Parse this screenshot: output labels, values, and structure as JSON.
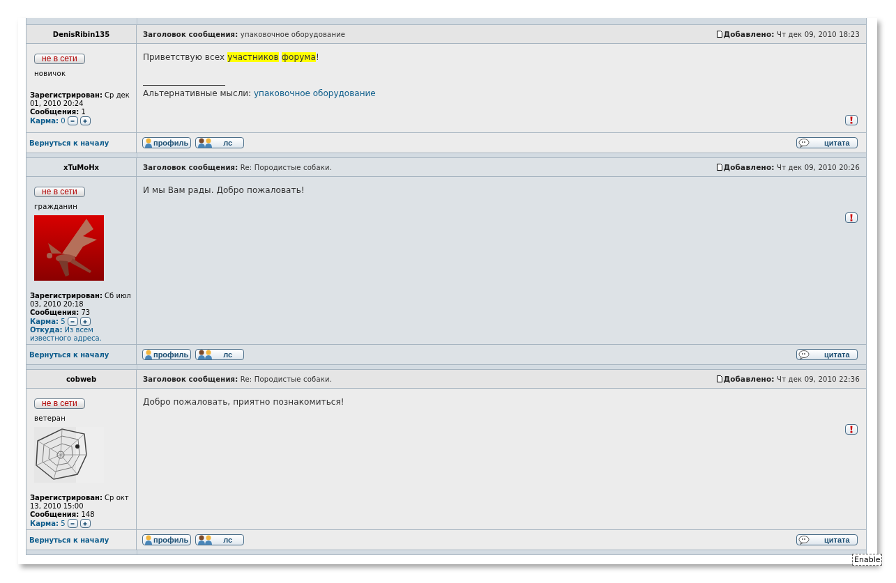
{
  "posts": [
    {
      "alternate": false,
      "author": "DenisRibin135",
      "status": "не в сети",
      "rank": "новичок",
      "registered_label": "Зарегистрирован:",
      "registered": "Ср дек 01, 2010 20:24",
      "messages_label": "Сообщения:",
      "messages": "1",
      "karma_label": "Карма:",
      "karma": "0",
      "subject_label": "Заголовок сообщения:",
      "subject": "упаковочное оборудование",
      "added_label": "Добавлено:",
      "added": "Чт дек 09, 2010 18:23",
      "body": [
        {
          "text": "Приветствую всех ",
          "highlight": false
        },
        {
          "text": "участников ",
          "highlight": true
        },
        {
          "text": "форума",
          "highlight": true
        },
        {
          "text": "!",
          "highlight": false
        }
      ],
      "signature": {
        "text": "Альтернативные мысли:",
        "link": "упаковочное оборудование"
      },
      "back": "Вернуться к началу",
      "profile": "профиль",
      "pm": "лс",
      "quote": "цитата"
    },
    {
      "alternate": true,
      "author": "xTuMoHx",
      "status": "не в сети",
      "rank": "гражданин",
      "registered_label": "Зарегистрирован:",
      "registered": "Сб июл 03, 2010 20:18",
      "messages_label": "Сообщения:",
      "messages": "73",
      "karma_label": "Карма:",
      "karma": "5",
      "from_label": "Откуда:",
      "from": "Из всем известного адреса.",
      "subject_label": "Заголовок сообщения:",
      "subject": "Re: Породистые собаки.",
      "added_label": "Добавлено:",
      "added": "Чт дек 09, 2010 20:26",
      "body": [
        {
          "text": "И мы Вам рады. Добро пожаловать!",
          "highlight": false
        }
      ],
      "back": "Вернуться к началу",
      "profile": "профиль",
      "pm": "лс",
      "quote": "цитата"
    },
    {
      "alternate": false,
      "author": "cobweb",
      "status": "не в сети",
      "rank": "ветеран",
      "registered_label": "Зарегистрирован:",
      "registered": "Ср окт 13, 2010 15:00",
      "messages_label": "Сообщения:",
      "messages": "148",
      "karma_label": "Карма:",
      "karma": "5",
      "subject_label": "Заголовок сообщения:",
      "subject": "Re: Породистые собаки.",
      "added_label": "Добавлено:",
      "added": "Чт дек 09, 2010 22:36",
      "body": [
        {
          "text": "Добро пожаловать, приятно познакомиться!",
          "highlight": false
        }
      ],
      "back": "Вернуться к началу",
      "profile": "профиль",
      "pm": "лс",
      "quote": "цитата"
    }
  ],
  "tooltip": "Enable"
}
